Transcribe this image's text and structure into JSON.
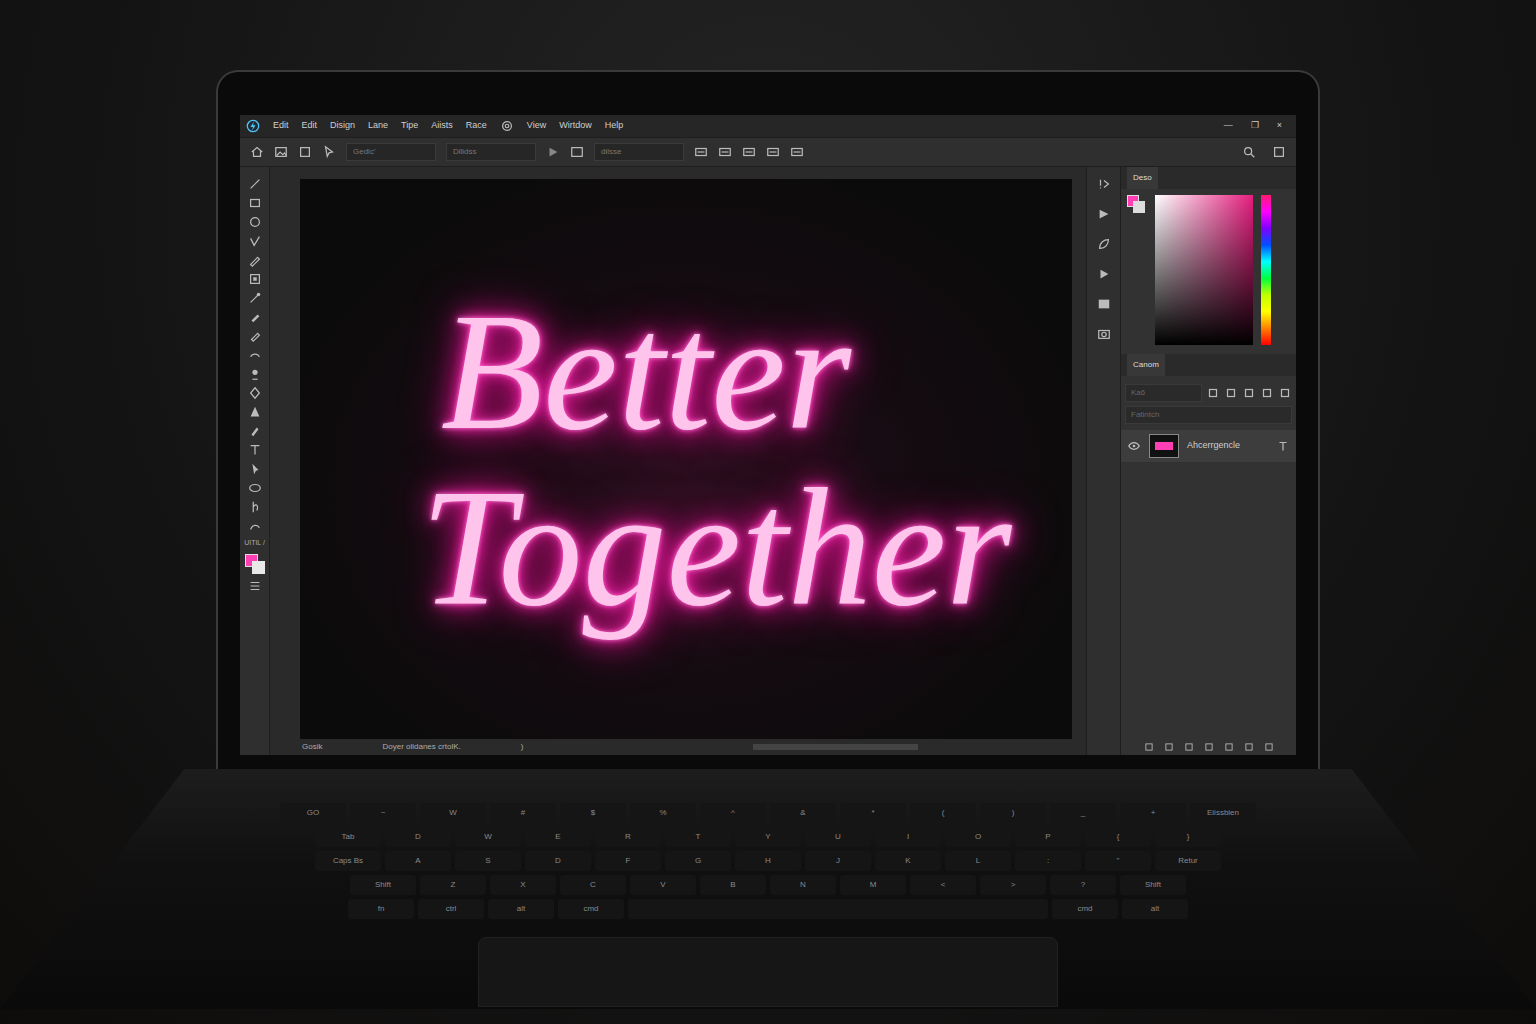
{
  "menu": [
    "Edit",
    "Edit",
    "Disign",
    "Lane",
    "Tipe",
    "Aiists",
    "Race",
    "View",
    "Wirtdow",
    "Help"
  ],
  "window_controls": [
    "—",
    "❐",
    "×"
  ],
  "toolbar": {
    "fields": [
      "Gedic'",
      "Dilidss",
      "dilsse"
    ]
  },
  "tools_label": "UITIL /",
  "canvas": {
    "lines": [
      "Better",
      "Together"
    ]
  },
  "status_bar": [
    "Gosik",
    "Doyer olidanes crtolK.",
    ")"
  ],
  "color_panel": {
    "title": "Deso"
  },
  "layers_panel": {
    "title": "Canom",
    "search": "Ka6",
    "filter": "Fatintch",
    "layers": [
      {
        "name": "Ahcerrgencle",
        "visible": true,
        "selected": true
      }
    ]
  },
  "keyboard": {
    "rows": [
      [
        "GO",
        "~",
        "W",
        "#",
        "$",
        "%",
        "^",
        "&",
        "*",
        "(",
        ")",
        "_",
        "+",
        "Eiissblen"
      ],
      [
        "Tab",
        "D",
        "W",
        "E",
        "R",
        "T",
        "Y",
        "U",
        "I",
        "O",
        "P",
        "{",
        "}"
      ],
      [
        "Caps Bs",
        "A",
        "S",
        "D",
        "F",
        "G",
        "H",
        "J",
        "K",
        "L",
        ":",
        "\"",
        "Retur"
      ],
      [
        "Shift",
        "Z",
        "X",
        "C",
        "V",
        "B",
        "N",
        "M",
        "<",
        ">",
        "?",
        "Shift"
      ],
      [
        "fn",
        "ctrl",
        "alt",
        "cmd",
        "",
        "cmd",
        "alt"
      ]
    ]
  }
}
